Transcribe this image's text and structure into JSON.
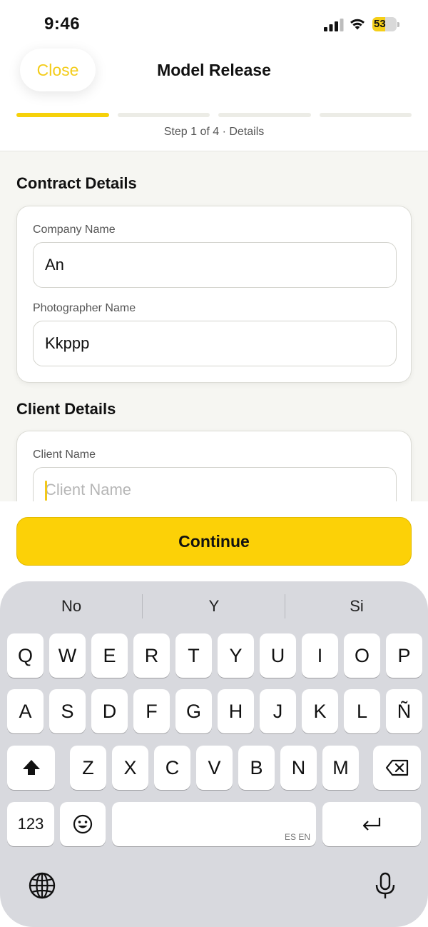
{
  "status_bar": {
    "time": "9:46",
    "battery_level": "53"
  },
  "header": {
    "close_label": "Close",
    "title": "Model Release",
    "step_label": "Step 1 of 4 · Details",
    "steps_total": 4,
    "current_step": 1
  },
  "sections": {
    "contract_title": "Contract Details",
    "client_title": "Client Details"
  },
  "contract": {
    "company_label": "Company Name",
    "company_value": "An",
    "photographer_label": "Photographer Name",
    "photographer_value": "Kkppp"
  },
  "client": {
    "client_label": "Client Name",
    "client_placeholder": "Client Name"
  },
  "action": {
    "continue_label": "Continue"
  },
  "keyboard": {
    "suggestions": [
      "No",
      "Y",
      "Si"
    ],
    "row1": [
      "Q",
      "W",
      "E",
      "R",
      "T",
      "Y",
      "U",
      "I",
      "O",
      "P"
    ],
    "row2": [
      "A",
      "S",
      "D",
      "F",
      "G",
      "H",
      "J",
      "K",
      "L",
      "Ñ"
    ],
    "row3": [
      "Z",
      "X",
      "C",
      "V",
      "B",
      "N",
      "M"
    ],
    "numbers_label": "123",
    "space_languages": "ES EN"
  },
  "colors": {
    "accent": "#fcd107",
    "close_text": "#f3cc1a",
    "background": "#f6f6f2"
  }
}
